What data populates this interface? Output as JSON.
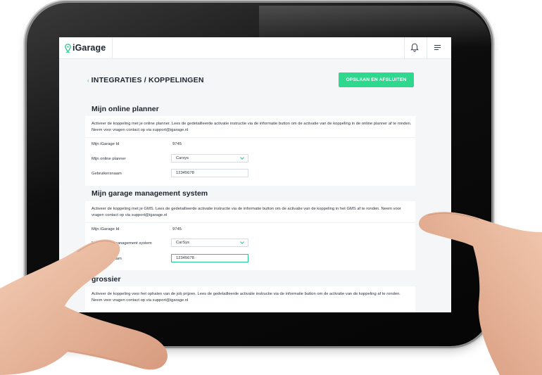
{
  "header": {
    "logo_text": "iGarage",
    "icons": [
      "pin-icon",
      "bell-icon",
      "menu-icon"
    ]
  },
  "page": {
    "back_arrow": "‹",
    "title": "INTEGRATIES / KOPPELINGEN",
    "save_button": "OPSLAAN EN AFSLUITEN"
  },
  "planner": {
    "title": "Mijn online planner",
    "description": "Activeer de koppeling met je online planner. Lees de gedetailleerde activatie instructie via de informatie button om de activatie van de koppeling in de online planner af te ronden. Neem voor vragen contact op via support@igarage.nl",
    "id_label": "Mijn iGarage Id",
    "id_value": "9745",
    "planner_label": "Mijn online planner",
    "planner_value": "Carsys",
    "username_label": "Gebruikersnaam",
    "username_value": "12345678"
  },
  "gms": {
    "title": "Mijn garage management system",
    "description": "Activeer de koppeling met je GMS. Lees de gedetailleerde activatie instructie via de informatie button om de activatie van de koppeling in het GMS af te ronden. Neem voor vragen contact op via support@igarage.nl",
    "id_label": "Mijn iGarage Id",
    "id_value": "9745",
    "system_label": "Mijn garage management system",
    "system_value": "CarSys",
    "username_label": "Gebruikersnaam",
    "username_value": "12345678"
  },
  "grossier": {
    "title": "grossier",
    "description": "Activeer de koppeling voor het ophalen van de job prijzen. Lees de gedetailleerde activatie instructie via de informatie button om de activatie van de koppeling af te ronden. Neem voor vragen contact op via support@igarage.nl"
  },
  "colors": {
    "accent": "#2ed98f",
    "background": "#f4f6f8",
    "text": "#1c2530"
  }
}
